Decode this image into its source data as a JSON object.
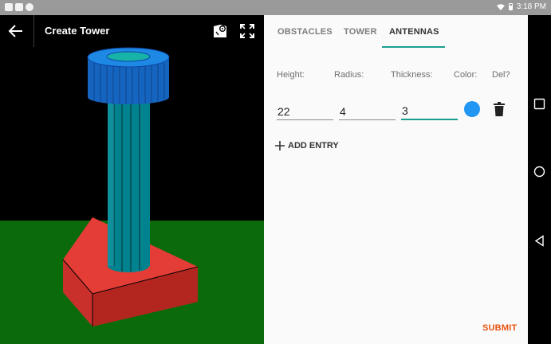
{
  "status_bar": {
    "time": "3:18 PM"
  },
  "app_bar": {
    "title": "Create Tower",
    "back_icon": "arrow-left-icon",
    "map_icon": "map-marker-icon",
    "fullscreen_icon": "fullscreen-icon"
  },
  "tabs": [
    {
      "label": "OBSTACLES",
      "selected": false
    },
    {
      "label": "TOWER",
      "selected": false
    },
    {
      "label": "ANTENNAS",
      "selected": true
    }
  ],
  "antennas": {
    "columns": {
      "height": "Height:",
      "radius": "Radius:",
      "thickness": "Thickness:",
      "color": "Color:",
      "del": "Del?"
    },
    "entries": [
      {
        "height": "22",
        "radius": "4",
        "thickness": "3",
        "color": "#2196f3"
      }
    ],
    "add_entry_label": "ADD ENTRY"
  },
  "submit_label": "SUBMIT",
  "colors": {
    "accent": "#1a9e8f",
    "submit": "#e8530f",
    "tower_top": "#1565c0",
    "tower_shaft": "#00838f",
    "tower_base": "#e53935",
    "ground": "#0b6b0b"
  }
}
